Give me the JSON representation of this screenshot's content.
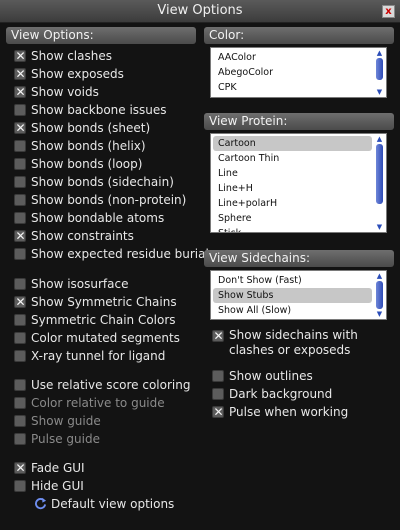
{
  "window": {
    "title": "View Options",
    "close_glyph": "x"
  },
  "view_options": {
    "header": "View Options:",
    "items": [
      {
        "label": "Show clashes",
        "checked": true
      },
      {
        "label": "Show exposeds",
        "checked": true
      },
      {
        "label": "Show voids",
        "checked": true
      },
      {
        "label": "Show backbone issues",
        "checked": false
      },
      {
        "label": "Show bonds (sheet)",
        "checked": true
      },
      {
        "label": "Show bonds (helix)",
        "checked": false
      },
      {
        "label": "Show bonds (loop)",
        "checked": false
      },
      {
        "label": "Show bonds (sidechain)",
        "checked": false
      },
      {
        "label": "Show bonds (non-protein)",
        "checked": false
      },
      {
        "label": "Show bondable atoms",
        "checked": false
      },
      {
        "label": "Show constraints",
        "checked": true
      },
      {
        "label": "Show expected residue burials",
        "checked": false
      },
      {
        "label": "Show isosurface",
        "checked": false
      },
      {
        "label": "Show Symmetric Chains",
        "checked": true
      },
      {
        "label": "Symmetric Chain Colors",
        "checked": false
      },
      {
        "label": "Color mutated segments",
        "checked": false
      },
      {
        "label": "X-ray tunnel for ligand",
        "checked": false
      },
      {
        "label": "Use relative score coloring",
        "checked": false
      },
      {
        "label": "Color relative to guide",
        "checked": false,
        "disabled": true
      },
      {
        "label": "Show guide",
        "checked": false,
        "disabled": true
      },
      {
        "label": "Pulse guide",
        "checked": false,
        "disabled": true
      },
      {
        "label": "Fade GUI",
        "checked": true
      },
      {
        "label": "Hide GUI",
        "checked": false
      }
    ],
    "default_button": "Default view options"
  },
  "color": {
    "header": "Color:",
    "items": [
      "AAColor",
      "AbegoColor",
      "CPK"
    ],
    "selected": null
  },
  "view_protein": {
    "header": "View Protein:",
    "items": [
      "Cartoon",
      "Cartoon Thin",
      "Line",
      "Line+H",
      "Line+polarH",
      "Sphere",
      "Stick"
    ],
    "selected": "Cartoon"
  },
  "view_sidechains": {
    "header": "View Sidechains:",
    "items": [
      "Don't Show (Fast)",
      "Show Stubs",
      "Show All (Slow)"
    ],
    "selected": "Show Stubs"
  },
  "right_options": [
    {
      "label": "Show sidechains with clashes or exposeds",
      "checked": true
    },
    {
      "label": "Show outlines",
      "checked": false
    },
    {
      "label": "Dark background",
      "checked": false
    },
    {
      "label": "Pulse when working",
      "checked": true
    }
  ],
  "colors": {
    "scroll_accent": "#2e4bb5",
    "header_bg": "#5a5a5a",
    "bg": "#131313"
  }
}
